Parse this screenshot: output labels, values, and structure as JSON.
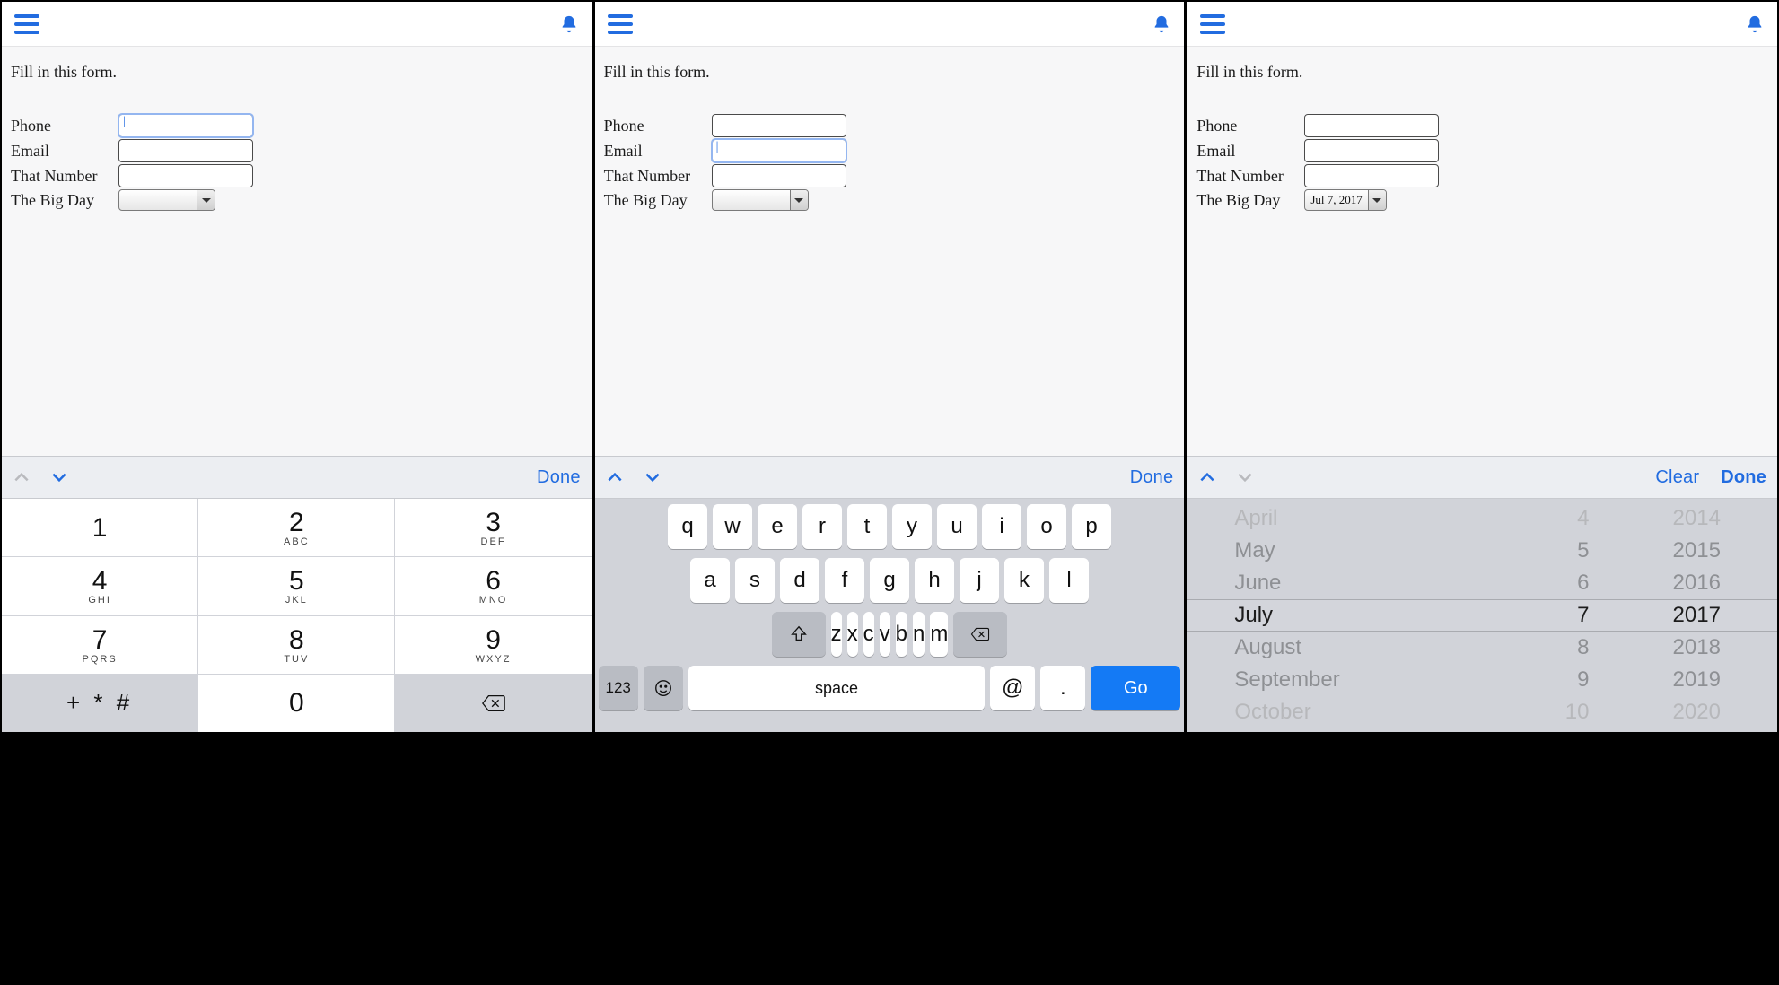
{
  "shared": {
    "prompt": "Fill in this form.",
    "labels": {
      "phone": "Phone",
      "email": "Email",
      "number": "That Number",
      "date": "The Big Day"
    },
    "toolbar": {
      "done": "Done",
      "clear": "Clear"
    }
  },
  "screen3": {
    "date_display": "Jul 7, 2017",
    "picker": {
      "months": [
        "April",
        "May",
        "June",
        "July",
        "August",
        "September",
        "October"
      ],
      "days": [
        "4",
        "5",
        "6",
        "7",
        "8",
        "9",
        "10"
      ],
      "years": [
        "2014",
        "2015",
        "2016",
        "2017",
        "2018",
        "2019",
        "2020"
      ],
      "selected_index": 3
    }
  },
  "numpad": {
    "keys": [
      {
        "d": "1",
        "s": ""
      },
      {
        "d": "2",
        "s": "ABC"
      },
      {
        "d": "3",
        "s": "DEF"
      },
      {
        "d": "4",
        "s": "GHI"
      },
      {
        "d": "5",
        "s": "JKL"
      },
      {
        "d": "6",
        "s": "MNO"
      },
      {
        "d": "7",
        "s": "PQRS"
      },
      {
        "d": "8",
        "s": "TUV"
      },
      {
        "d": "9",
        "s": "WXYZ"
      }
    ],
    "symbol": "+ * #",
    "zero": "0"
  },
  "qwerty": {
    "row1": [
      "q",
      "w",
      "e",
      "r",
      "t",
      "y",
      "u",
      "i",
      "o",
      "p"
    ],
    "row2": [
      "a",
      "s",
      "d",
      "f",
      "g",
      "h",
      "j",
      "k",
      "l"
    ],
    "row3": [
      "z",
      "x",
      "c",
      "v",
      "b",
      "n",
      "m"
    ],
    "num_label": "123",
    "space": "space",
    "at": "@",
    "dot": ".",
    "go": "Go"
  }
}
